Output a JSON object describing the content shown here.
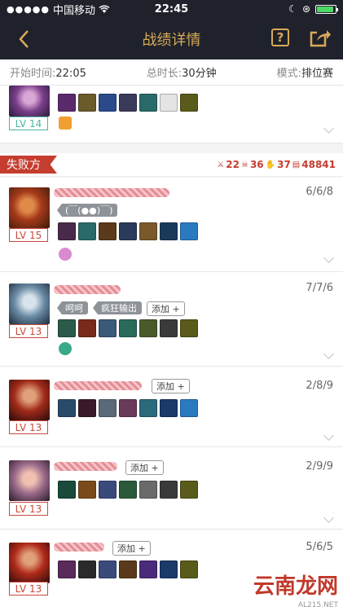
{
  "status": {
    "carrier": "中国移动",
    "time": "22:45"
  },
  "nav": {
    "title": "战绩详情",
    "help_label": "?"
  },
  "info": {
    "start_label": "开始时间:",
    "start_value": "22:05",
    "duration_label": "总时长:",
    "duration_value": "30分钟",
    "mode_label": "模式:",
    "mode_value": "排位赛"
  },
  "section": {
    "label": "失败方",
    "totals": {
      "kills": "22",
      "deaths": "36",
      "assists": "37",
      "gold": "48841"
    }
  },
  "top_row": {
    "level": "LV 14"
  },
  "players": [
    {
      "level": "LV 15",
      "kda": "6/6/8",
      "tags": [
        "(￣(●●)￣)"
      ],
      "add_label": ""
    },
    {
      "level": "LV 13",
      "kda": "7/7/6",
      "tags": [
        "呵呵",
        "疯狂输出"
      ],
      "add_label": "添加 +"
    },
    {
      "level": "LV 13",
      "kda": "2/8/9",
      "tags": [],
      "add_label": "添加 +"
    },
    {
      "level": "LV 13",
      "kda": "2/9/9",
      "tags": [],
      "add_label": "添加 +"
    },
    {
      "level": "LV 13",
      "kda": "5/6/5",
      "tags": [],
      "add_label": "添加 +"
    }
  ],
  "watermark": {
    "main": "云南龙网",
    "sub": "AL215.NET"
  }
}
